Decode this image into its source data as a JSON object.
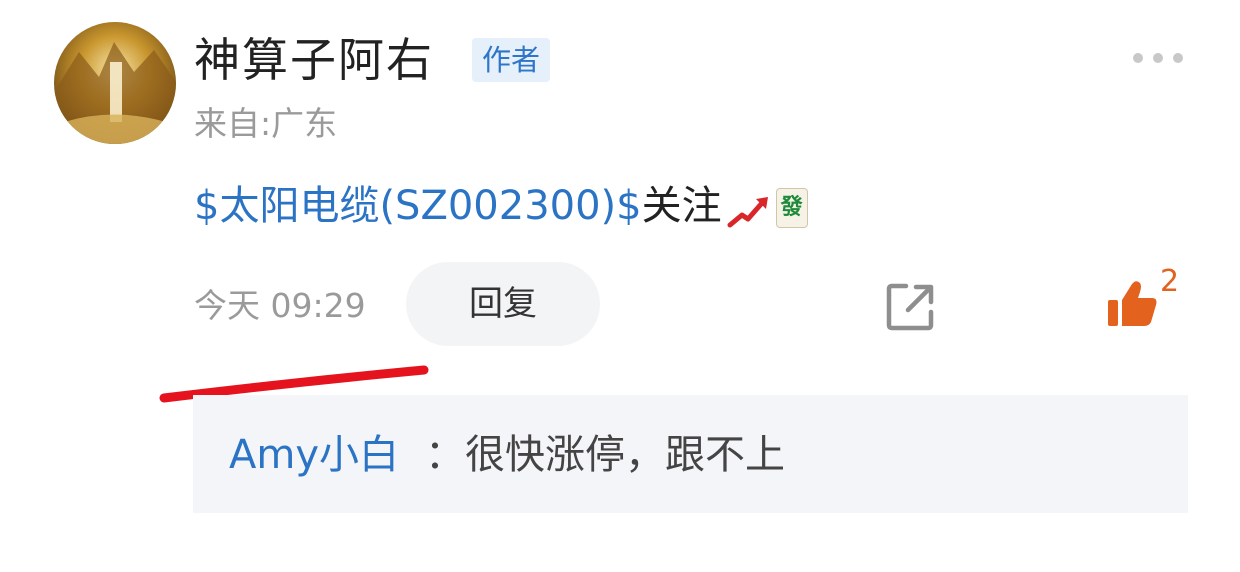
{
  "post": {
    "username": "神算子阿右",
    "author_badge": "作者",
    "location": "来自:广东",
    "stock_link": "$太阳电缆(SZ002300)$",
    "content_suffix": "关注",
    "emoji_tile": "發",
    "timestamp": "今天 09:29",
    "reply_label": "回复",
    "like_count": "2"
  },
  "reply": {
    "author": "Amy小白",
    "text": "：很快涨停，跟不上"
  },
  "icons": {
    "more": "more-dots-icon",
    "share": "share-icon",
    "like": "thumbs-up-icon",
    "trend": "trend-up-arrow-icon"
  },
  "colors": {
    "link_blue": "#2b73c4",
    "like_orange": "#e2621e",
    "annotation_red": "#e5131e",
    "muted_gray": "#9a9a9a"
  }
}
